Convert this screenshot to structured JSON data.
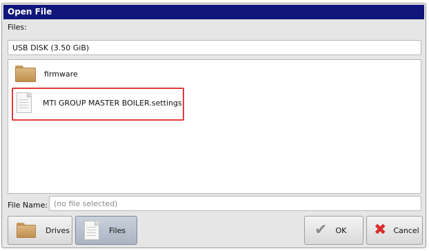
{
  "dialog": {
    "title": "Open File"
  },
  "files_label": "Files:",
  "drive_selector": {
    "value": "USB DISK (3.50 GiB)"
  },
  "file_list": {
    "items": [
      {
        "name": "firmware",
        "icon": "folder-icon"
      },
      {
        "name": "MTI GROUP MASTER BOILER.settings",
        "icon": "document-icon"
      }
    ]
  },
  "file_name": {
    "label": "File Name:",
    "value": "(no file selected)"
  },
  "buttons": {
    "drives": "Drives",
    "files": "Files",
    "ok": "OK",
    "cancel": "Cancel"
  },
  "colors": {
    "titlebar": "#10167a",
    "highlight": "#e33b3b",
    "cancel_icon": "#d92d2d"
  }
}
